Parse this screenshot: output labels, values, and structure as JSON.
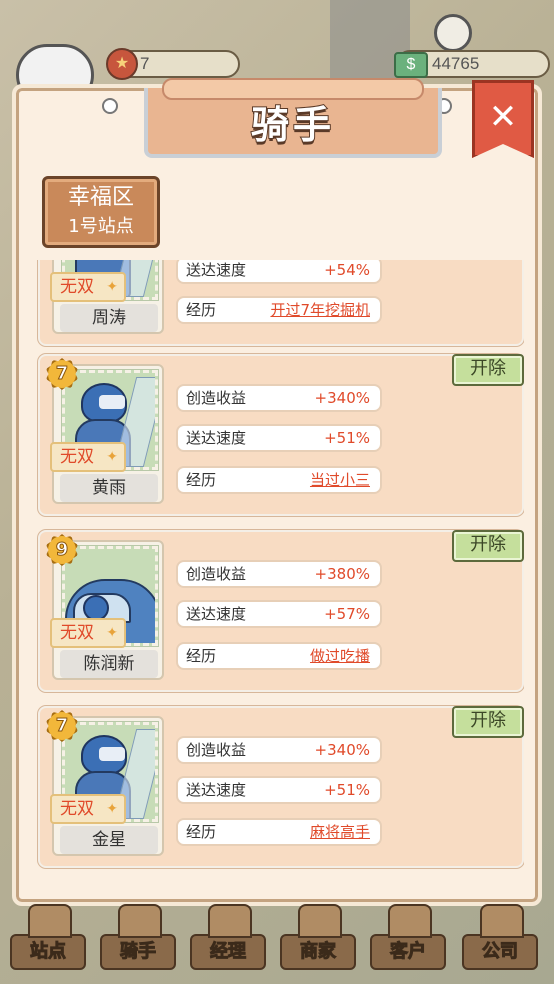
{
  "resources": {
    "stars": "7",
    "money": "44765"
  },
  "modal": {
    "title": "骑手",
    "close_icon": "fork-knife-icon"
  },
  "district": {
    "line1": "幸福区",
    "line2": "1号站点"
  },
  "labels": {
    "income": "创造收益",
    "speed": "送达速度",
    "history": "经历",
    "fire": "开除",
    "tag": "无双"
  },
  "riders": [
    {
      "name": "周涛",
      "level": "",
      "income": "",
      "speed": "+54%",
      "history": "开过7年挖掘机",
      "vehicle": "motorbike"
    },
    {
      "name": "黄雨",
      "level": "7",
      "income": "+340%",
      "speed": "+51%",
      "history": "当过小三",
      "vehicle": "motorbike"
    },
    {
      "name": "陈润新",
      "level": "9",
      "income": "+380%",
      "speed": "+57%",
      "history": "做过吃播",
      "vehicle": "car"
    },
    {
      "name": "金星",
      "level": "7",
      "income": "+340%",
      "speed": "+51%",
      "history": "麻将高手",
      "vehicle": "motorbike"
    }
  ],
  "nav": [
    "站点",
    "骑手",
    "经理",
    "商家",
    "客户",
    "公司"
  ]
}
